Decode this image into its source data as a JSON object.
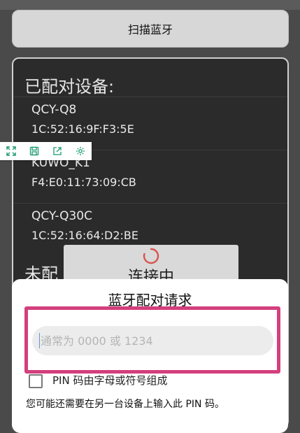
{
  "toolbar": {
    "scan_label": "扫描蓝牙"
  },
  "paired": {
    "title": "已配对设备:",
    "devices": [
      {
        "name": "QCY-Q8",
        "mac": "1C:52:16:9F:F3:5E"
      },
      {
        "name": "KUWO_K1",
        "mac": "F4:E0:11:73:09:CB"
      },
      {
        "name": "QCY-Q30C",
        "mac": "1C:52:16:64:D2:BE"
      }
    ]
  },
  "unpaired": {
    "title_partial": "未配"
  },
  "float_toolbar": {
    "icons": [
      "expand-icon",
      "save-icon",
      "share-icon",
      "settings-icon"
    ]
  },
  "connecting": {
    "text": "连接中"
  },
  "dialog": {
    "title": "蓝牙配对请求",
    "pin_placeholder": "通常为 0000 或 1234",
    "checkbox_label": "PIN 码由字母或符号组成",
    "hint": "您可能还需要在另一台设备上输入此 PIN 码。"
  },
  "colors": {
    "highlight": "#d43f7d",
    "accent": "#1a9b6c"
  }
}
